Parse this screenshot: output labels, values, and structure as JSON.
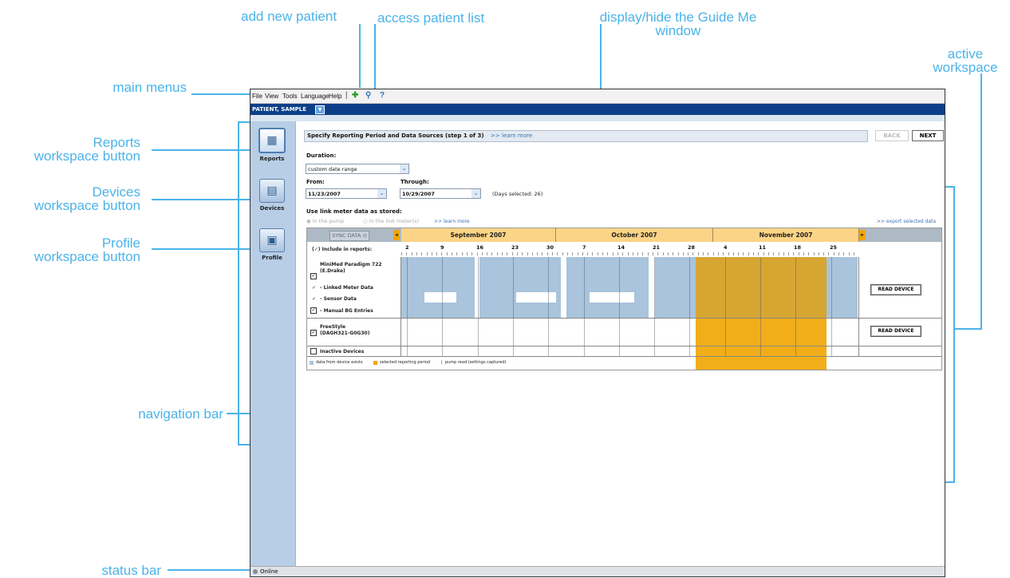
{
  "callouts": {
    "add_new_patient": "add new patient",
    "access_patient_list": "access patient list",
    "guide_me": [
      "display/hide the Guide Me",
      "window"
    ],
    "active_workspace": [
      "active",
      "workspace"
    ],
    "main_menus": "main menus",
    "reports_button": [
      "Reports",
      "workspace button"
    ],
    "devices_button": [
      "Devices",
      "workspace button"
    ],
    "profile_button": [
      "Profile",
      "workspace button"
    ],
    "navigation_bar": "navigation bar",
    "status_bar": "status bar"
  },
  "menubar": {
    "items": [
      "File",
      "View",
      "Tools",
      "Language",
      "Help"
    ]
  },
  "toolbar_icons": [
    "add-patient-icon",
    "search-icon",
    "help-icon"
  ],
  "patient": {
    "name": "PATIENT, SAMPLE"
  },
  "nav": {
    "items": [
      {
        "label": "Reports",
        "icon": "reports-icon",
        "active": true
      },
      {
        "label": "Devices",
        "icon": "devices-icon",
        "active": false
      },
      {
        "label": "Profile",
        "icon": "profile-icon",
        "active": false
      }
    ]
  },
  "workspace": {
    "step_title": "Specify Reporting Period and Data Sources (step 1 of 3)",
    "learn_more": ">> learn more",
    "back_label": "BACK",
    "next_label": "NEXT",
    "duration_label": "Duration:",
    "duration_value": "custom date range",
    "from_label": "From:",
    "from_value": "11/23/2007",
    "through_label": "Through:",
    "through_value": "10/29/2007",
    "days_selected": "(Days selected: 26)",
    "link_meter_label": "Use link meter data as stored:",
    "radio_pump": "in the pump",
    "radio_meter": "in the link meter(s)",
    "export_link": ">> export selected data"
  },
  "calendar": {
    "sync_label": "SYNC DATA",
    "months": [
      "September 2007",
      "October 2007",
      "November 2007"
    ],
    "days": [
      "2",
      "9",
      "16",
      "23",
      "30",
      "7",
      "14",
      "21",
      "28",
      "4",
      "11",
      "18",
      "25"
    ],
    "include_label": "(✓) Include in reports:",
    "device1_name": "MiniMed Paradigm 722",
    "device1_sub": "(E.Drake)",
    "row_linked": "- Linked Meter Data",
    "row_sensor": "- Sensor Data",
    "row_manual": "- Manual BG Entries",
    "device2_name": "FreeStyle",
    "device2_sub": "(DAGH321-G0G30)",
    "inactive": "Inactive Devices",
    "read_device": "READ DEVICE",
    "legend_exists": "data from device exists",
    "legend_selected": "selected reporting period",
    "legend_pump": "pump read (settings captured)",
    "colors": {
      "data": "#a9c4dc",
      "selected": "#f0a500"
    }
  },
  "status": {
    "text": "Online"
  }
}
